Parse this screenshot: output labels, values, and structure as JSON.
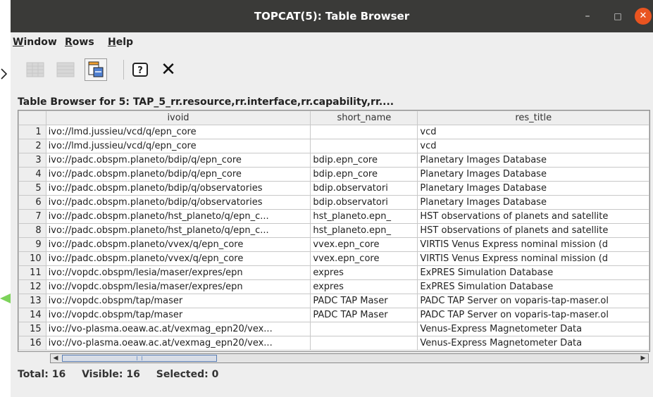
{
  "window": {
    "title": "TOPCAT(5): Table Browser",
    "controls": {
      "minimize": "–",
      "maximize": "□",
      "close": "✕"
    }
  },
  "menu": [
    {
      "label": "Window",
      "mnemonic": "W",
      "rest": "indow"
    },
    {
      "label": "Rows",
      "mnemonic": "R",
      "rest": "ows"
    },
    {
      "label": "Help",
      "mnemonic": "H",
      "rest": "elp"
    }
  ],
  "toolbar": {
    "icons": [
      "grid-icon",
      "grid-icon",
      "column-info-icon",
      "help-icon",
      "close-icon"
    ],
    "close_glyph": "✕",
    "help_glyph": "?"
  },
  "heading": "Table Browser for 5: TAP_5_rr.resource,rr.interface,rr.capability,rr....",
  "table": {
    "columns": [
      "ivoid",
      "short_name",
      "res_title"
    ],
    "rows": [
      [
        "1",
        "ivo://lmd.jussieu/vcd/q/epn_core",
        "",
        "vcd"
      ],
      [
        "2",
        "ivo://lmd.jussieu/vcd/q/epn_core",
        "",
        "vcd"
      ],
      [
        "3",
        "ivo://padc.obspm.planeto/bdip/q/epn_core",
        "bdip.epn_core",
        "Planetary Images Database"
      ],
      [
        "4",
        "ivo://padc.obspm.planeto/bdip/q/epn_core",
        "bdip.epn_core",
        "Planetary Images Database"
      ],
      [
        "5",
        "ivo://padc.obspm.planeto/bdip/q/observatories",
        "bdip.observatori",
        "Planetary Images Database"
      ],
      [
        "6",
        "ivo://padc.obspm.planeto/bdip/q/observatories",
        "bdip.observatori",
        "Planetary Images Database"
      ],
      [
        "7",
        "ivo://padc.obspm.planeto/hst_planeto/q/epn_c...",
        "hst_planeto.epn_",
        "HST observations of planets and satellite"
      ],
      [
        "8",
        "ivo://padc.obspm.planeto/hst_planeto/q/epn_c...",
        "hst_planeto.epn_",
        "HST observations of planets and satellite"
      ],
      [
        "9",
        "ivo://padc.obspm.planeto/vvex/q/epn_core",
        "vvex.epn_core",
        "VIRTIS Venus Express nominal mission (d"
      ],
      [
        "10",
        "ivo://padc.obspm.planeto/vvex/q/epn_core",
        "vvex.epn_core",
        "VIRTIS Venus Express nominal mission (d"
      ],
      [
        "11",
        "ivo://vopdc.obspm/lesia/maser/expres/epn",
        "expres",
        "ExPRES Simulation Database"
      ],
      [
        "12",
        "ivo://vopdc.obspm/lesia/maser/expres/epn",
        "expres",
        "ExPRES Simulation Database"
      ],
      [
        "13",
        "ivo://vopdc.obspm/tap/maser",
        "PADC TAP Maser",
        "PADC TAP Server on voparis-tap-maser.ol"
      ],
      [
        "14",
        "ivo://vopdc.obspm/tap/maser",
        "PADC TAP Maser",
        "PADC TAP Server on voparis-tap-maser.ol"
      ],
      [
        "15",
        "ivo://vo-plasma.oeaw.ac.at/vexmag_epn20/vex...",
        "",
        "Venus-Express Magnetometer Data"
      ],
      [
        "16",
        "ivo://vo-plasma.oeaw.ac.at/vexmag_epn20/vex...",
        "",
        "Venus-Express Magnetometer Data"
      ]
    ]
  },
  "scrollbar": {
    "left_arrow": "◀",
    "right_arrow": "▶"
  },
  "status": {
    "total_label": "Total: 16",
    "visible_label": "Visible: 16",
    "selected_label": "Selected: 0"
  },
  "colors": {
    "titlebar": "#3a3a38",
    "close_button": "#e95420",
    "annotation_arrow": "#7dd35a"
  }
}
